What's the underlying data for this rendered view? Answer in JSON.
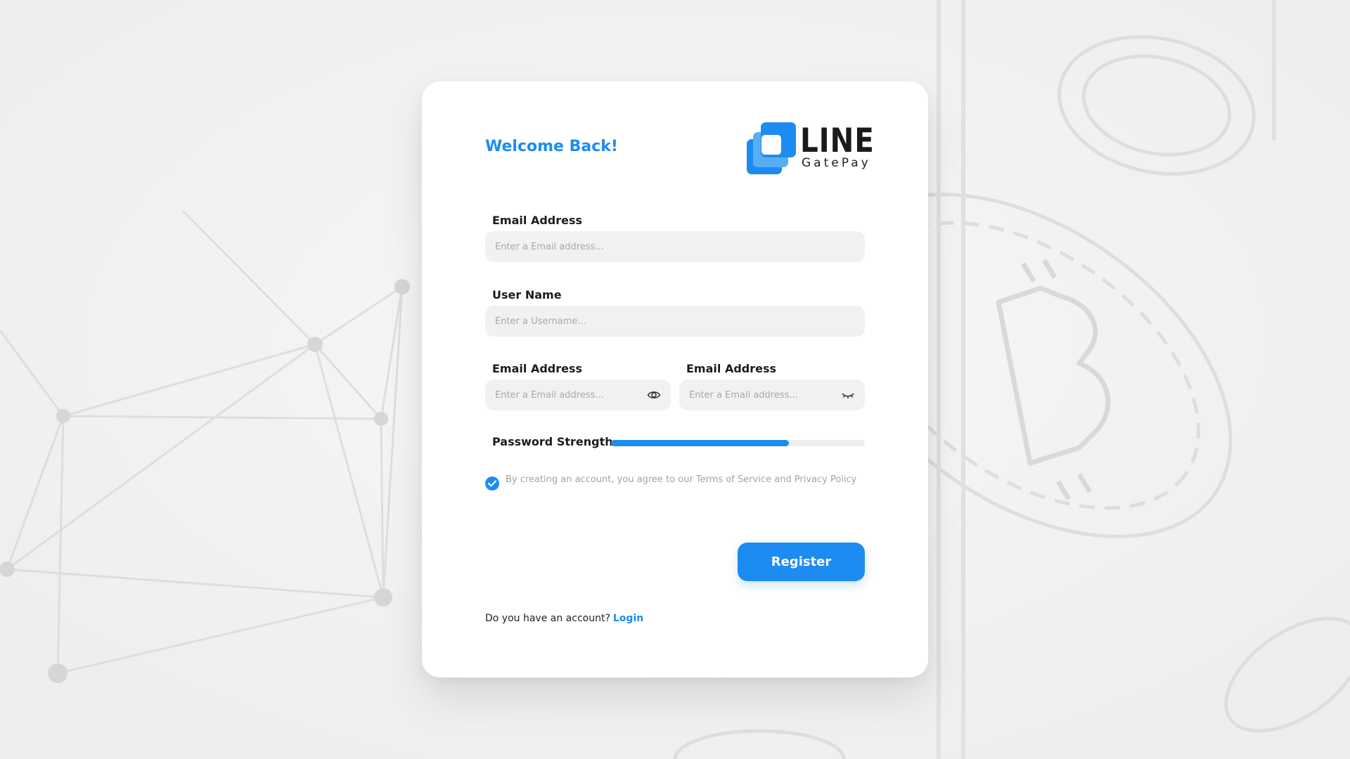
{
  "page": {
    "accent_color": "#1d8cf2",
    "background_theme": "blockchain network and crypto coins watermark"
  },
  "header": {
    "welcome": "Welcome Back!",
    "logo": {
      "word": "LINE",
      "sub": "GatePay"
    }
  },
  "form": {
    "email": {
      "label": "Email Address",
      "placeholder": "Enter a Email address...",
      "value": ""
    },
    "username": {
      "label": "User Name",
      "placeholder": "Enter a Username...",
      "value": ""
    },
    "password": {
      "label": "Email Address",
      "placeholder": "Enter a Email address...",
      "value": "",
      "icon": "eye-open-icon"
    },
    "confirm_password": {
      "label": "Email Address",
      "placeholder": "Enter a Email address...",
      "value": "",
      "icon": "eye-closed-icon"
    },
    "strength": {
      "label": "Password Strength",
      "level": 0.7
    },
    "agreement": {
      "checked": true,
      "text": "By creating an account, you agree to our Terms of Service and Privacy Policy"
    },
    "register_label": "Register"
  },
  "footer": {
    "question": "Do you have an account?",
    "login_label": "Login"
  }
}
